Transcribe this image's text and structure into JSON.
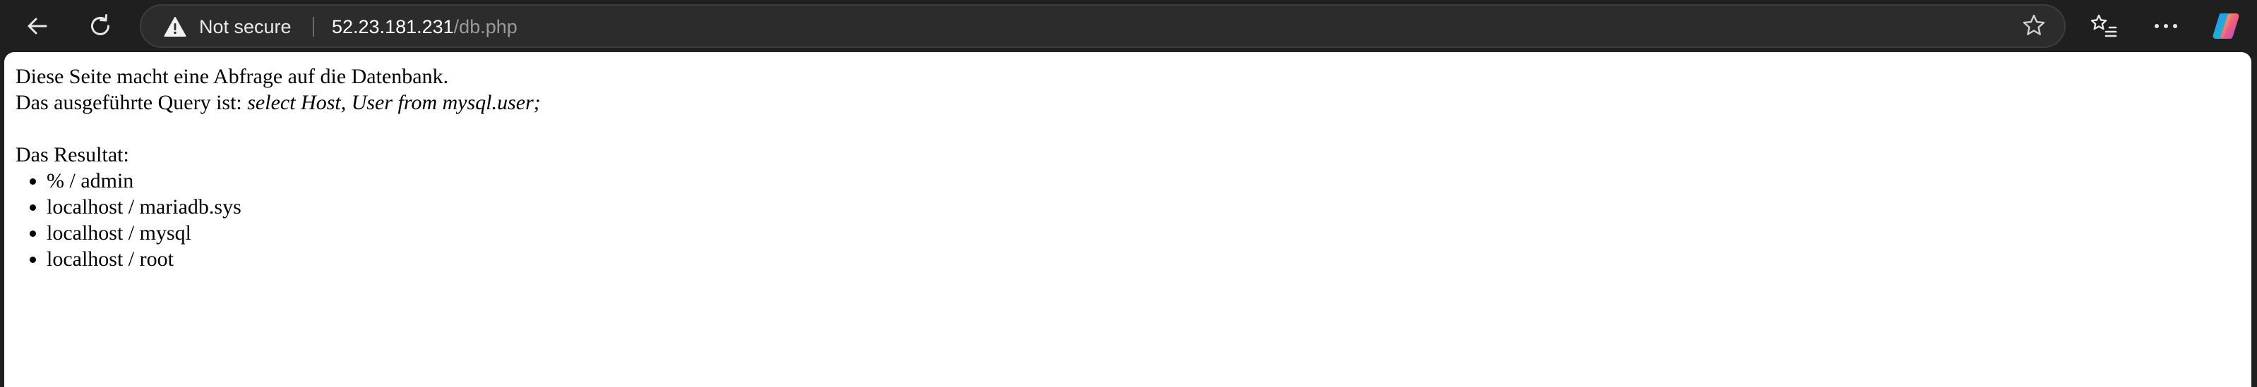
{
  "browser": {
    "security_label": "Not secure",
    "url_host": "52.23.181.231",
    "url_path": "/db.php"
  },
  "page": {
    "intro": "Diese Seite macht eine Abfrage auf die Datenbank.",
    "query_prefix": "Das ausgeführte Query ist: ",
    "query": "select Host, User from mysql.user;",
    "result_heading": "Das Resultat:",
    "results": [
      "% / admin",
      "localhost / mariadb.sys",
      "localhost / mysql",
      "localhost / root"
    ]
  },
  "icons": {
    "back": "arrow-left-icon",
    "reload": "refresh-icon",
    "warning": "warning-triangle-icon",
    "favorite": "star-icon",
    "favorites": "favorites-list-icon",
    "more": "more-dots-icon",
    "copilot": "copilot-icon"
  }
}
